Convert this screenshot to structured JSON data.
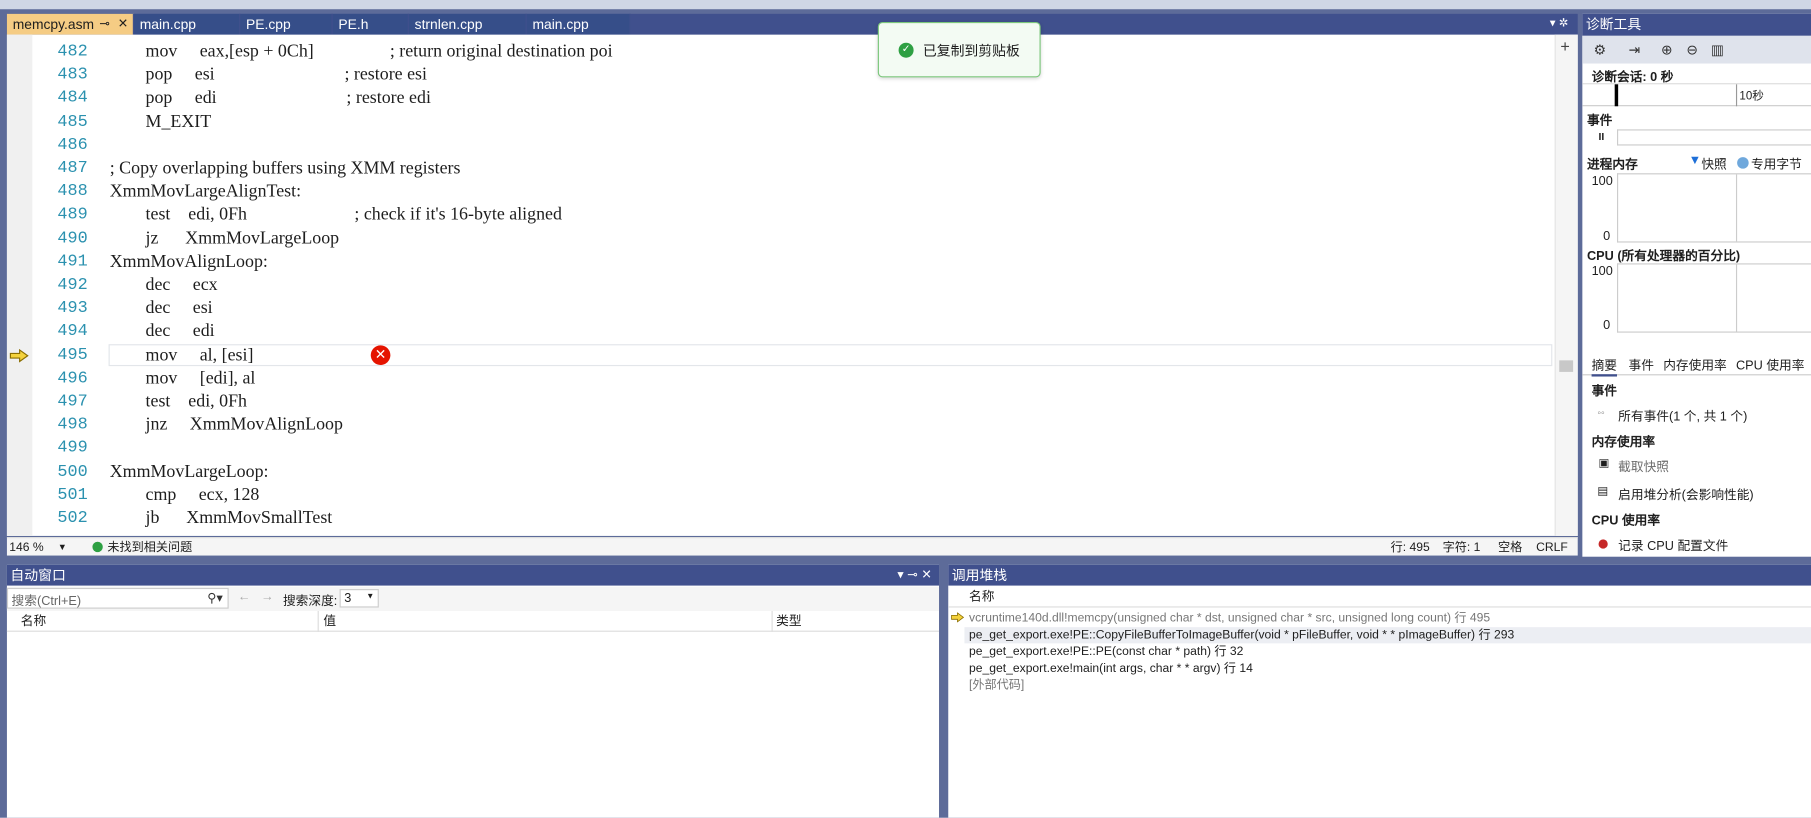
{
  "editor": {
    "tabs": [
      {
        "label": "memcpy.asm",
        "pin": "⊸",
        "close": "✕",
        "active": true
      },
      {
        "label": "main.cpp"
      },
      {
        "label": "PE.cpp"
      },
      {
        "label": "PE.h"
      },
      {
        "label": "strnlen.cpp"
      },
      {
        "label": "main.cpp"
      }
    ],
    "tabbar_right": "▾ ✲",
    "lines": [
      {
        "n": "482",
        "t": "        mov     eax,[esp + 0Ch]                 ; return original destination poi"
      },
      {
        "n": "483",
        "t": "        pop     esi                             ; restore esi"
      },
      {
        "n": "484",
        "t": "        pop     edi                             ; restore edi"
      },
      {
        "n": "485",
        "t": "        M_EXIT"
      },
      {
        "n": "486",
        "t": ""
      },
      {
        "n": "487",
        "t": "; Copy overlapping buffers using XMM registers"
      },
      {
        "n": "488",
        "t": "XmmMovLargeAlignTest:"
      },
      {
        "n": "489",
        "t": "        test    edi, 0Fh                        ; check if it's 16-byte aligned"
      },
      {
        "n": "490",
        "t": "        jz      XmmMovLargeLoop"
      },
      {
        "n": "491",
        "t": "XmmMovAlignLoop:"
      },
      {
        "n": "492",
        "t": "        dec     ecx"
      },
      {
        "n": "493",
        "t": "        dec     esi"
      },
      {
        "n": "494",
        "t": "        dec     edi"
      },
      {
        "n": "495",
        "t": "        mov     al, [esi]"
      },
      {
        "n": "496",
        "t": "        mov     [edi], al"
      },
      {
        "n": "497",
        "t": "        test    edi, 0Fh"
      },
      {
        "n": "498",
        "t": "        jnz     XmmMovAlignLoop"
      },
      {
        "n": "499",
        "t": ""
      },
      {
        "n": "500",
        "t": "XmmMovLargeLoop:"
      },
      {
        "n": "501",
        "t": "        cmp     ecx, 128"
      },
      {
        "n": "502",
        "t": "        jb      XmmMovSmallTest"
      }
    ],
    "current_line": "495",
    "zoom": "146 %",
    "issues": "未找到相关问题",
    "status_line": "行: 495",
    "status_char": "字符: 1",
    "status_space": "空格",
    "status_eol": "CRLF",
    "error_glyph": "✕",
    "toast": {
      "check": "✓",
      "message": "已复制到剪贴板"
    }
  },
  "diagnostics": {
    "title": "诊断工具",
    "session": "诊断会话: 0 秒",
    "tick": "10秒",
    "events_label": "事件",
    "pause_glyph": "II",
    "memory_label": "进程内存",
    "legend_snapshot": "快照",
    "legend_private": "专用字节",
    "mem_max": "100",
    "mem_min": "0",
    "cpu_label": "CPU (所有处理器的百分比)",
    "cpu_max": "100",
    "cpu_min": "0",
    "tabs": [
      "摘要",
      "事件",
      "内存使用率",
      "CPU 使用率"
    ],
    "sec_events": "事件",
    "all_events": "所有事件(1 个, 共 1 个)",
    "sec_memory": "内存使用率",
    "take_snapshot": "截取快照",
    "heap_analysis": "启用堆分析(会影响性能)",
    "sec_cpu": "CPU 使用率",
    "record_cpu": "记录 CPU 配置文件",
    "colors": {
      "snapshot": "#1e6fd8",
      "private": "#6fa8dc",
      "record": "#c62828"
    }
  },
  "auto_window": {
    "title": "自动窗口",
    "title_controls": "▾ ⊸ ✕",
    "search_placeholder": "搜索(Ctrl+E)",
    "search_depth_label": "搜索深度:",
    "search_depth_value": "3",
    "col_name": "名称",
    "col_value": "值",
    "col_type": "类型"
  },
  "call_stack": {
    "title": "调用堆栈",
    "col_name": "名称",
    "frames": [
      {
        "text": "vcruntime140d.dll!memcpy(unsigned char * dst, unsigned char * src, unsigned long count) 行 495",
        "current": true,
        "dim": true
      },
      {
        "text": "pe_get_export.exe!PE::CopyFileBufferToImageBuffer(void * pFileBuffer, void * * pImageBuffer) 行 293"
      },
      {
        "text": "pe_get_export.exe!PE::PE(const char * path) 行 32"
      },
      {
        "text": "pe_get_export.exe!main(int args, char * * argv) 行 14"
      },
      {
        "text": "[外部代码]",
        "dim": true
      }
    ]
  }
}
